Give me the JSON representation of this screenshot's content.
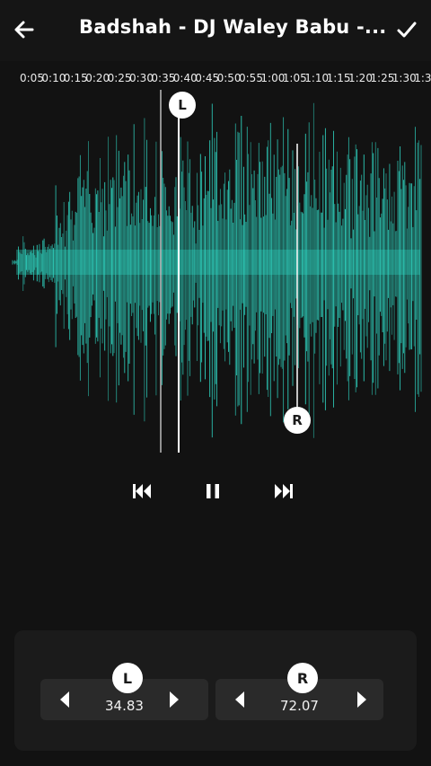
{
  "header": {
    "title": "Badshah - DJ Waley Babu -...",
    "back_icon": "arrow-left-icon",
    "confirm_icon": "check-icon"
  },
  "timeline": {
    "ticks": [
      "0:05",
      "0:10",
      "0:15",
      "0:20",
      "0:25",
      "0:30",
      "0:35",
      "0:40",
      "0:45",
      "0:50",
      "0:55",
      "1:00",
      "1:05",
      "1:10",
      "1:15",
      "1:20",
      "1:25",
      "1:30",
      "1:3"
    ]
  },
  "waveform": {
    "color": "#2fd3c0",
    "left_marker": "L",
    "right_marker": "R"
  },
  "transport": {
    "previous_icon": "skip-previous-icon",
    "pause_icon": "pause-icon",
    "next_icon": "skip-next-icon"
  },
  "trim": {
    "left": {
      "badge": "L",
      "value": "34.83"
    },
    "right": {
      "badge": "R",
      "value": "72.07"
    }
  }
}
